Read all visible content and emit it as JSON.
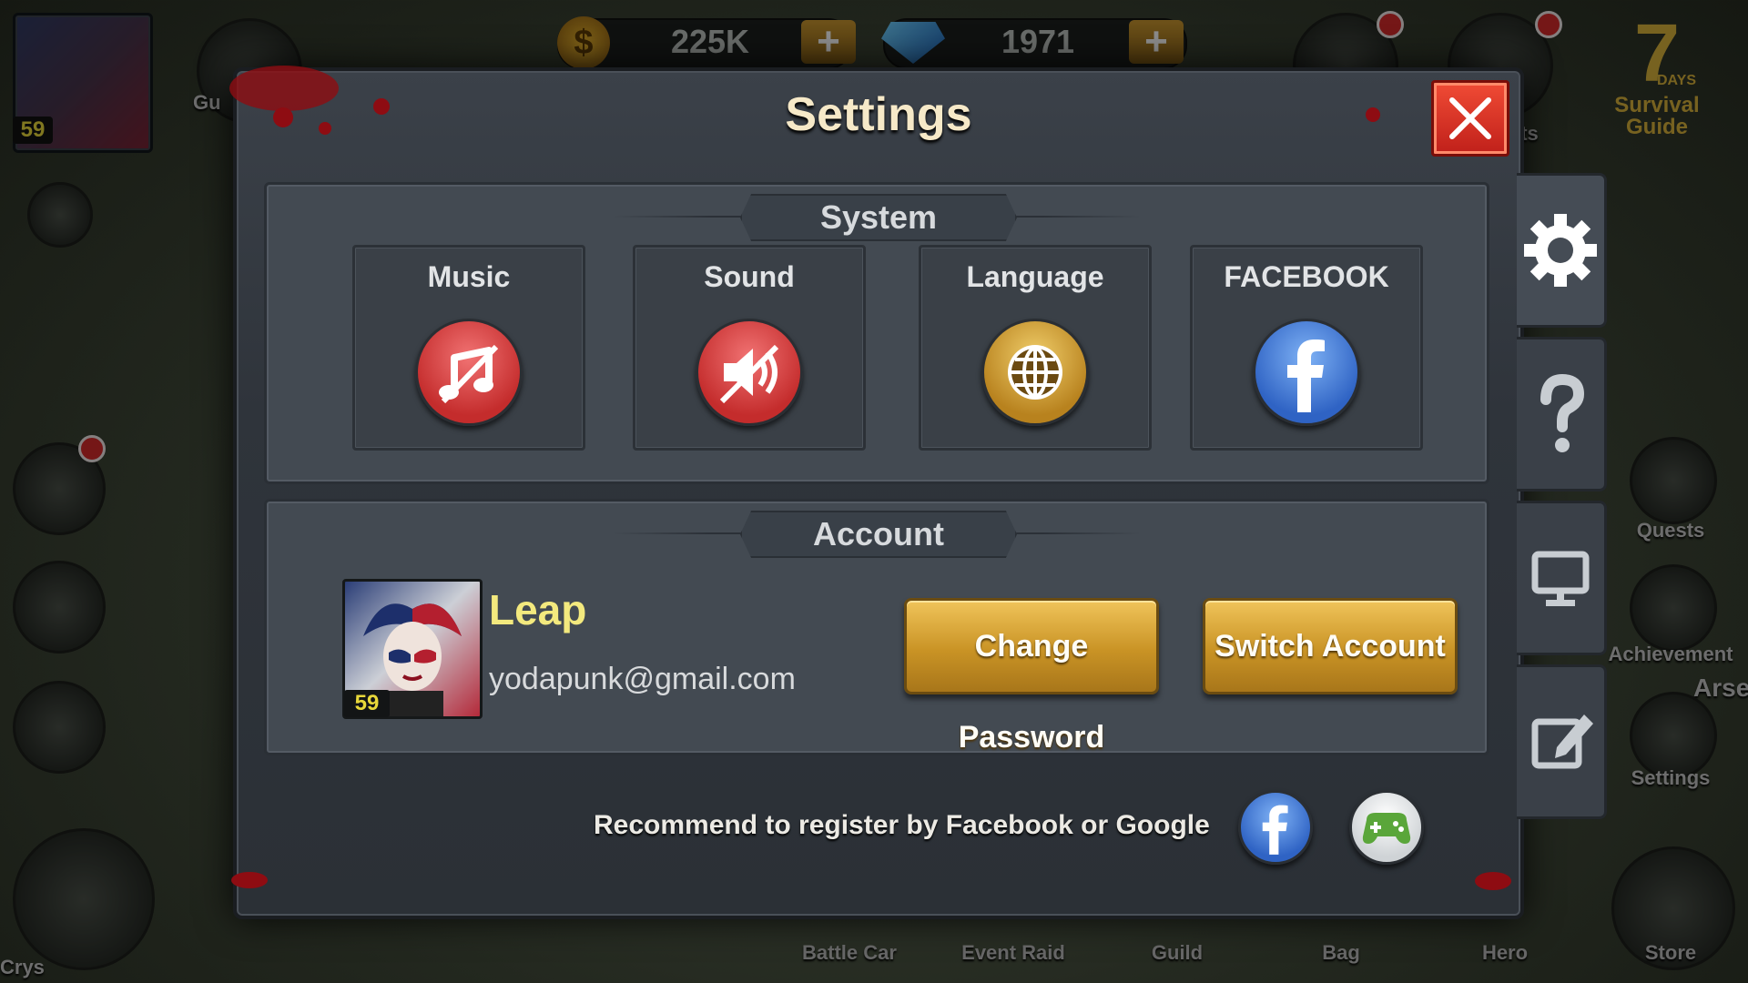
{
  "hud": {
    "player_level": "59",
    "gold_amount": "225K",
    "gem_amount": "1971",
    "gold_symbol": "$",
    "guild_partial": "Gu",
    "gifts_partial": "ts",
    "survival_guide_days": "7",
    "survival_guide_days_label": "DAYS",
    "survival_guide_label": "Survival Guide",
    "right_menu": [
      "Quests",
      "Achievement",
      "Settings"
    ],
    "arsenal_partial": "Arse",
    "bottom_menu": [
      "Battle Car",
      "Event Raid",
      "Guild",
      "Bag",
      "Hero",
      "Store"
    ],
    "crystal_partial": "Crys"
  },
  "dialog": {
    "title": "Settings",
    "system": {
      "heading": "System",
      "options": [
        {
          "label": "Music",
          "icon": "music-note-icon",
          "color": "#d94545"
        },
        {
          "label": "Sound",
          "icon": "sound-muted-icon",
          "color": "#d94545"
        },
        {
          "label": "Language",
          "icon": "globe-icon",
          "color": "#d9a63a"
        },
        {
          "label": "FACEBOOK",
          "icon": "facebook-icon",
          "color": "#3f78d8"
        }
      ]
    },
    "account": {
      "heading": "Account",
      "level": "59",
      "username": "Leap",
      "email": "yodapunk@gmail.com",
      "change_password_label": "Change Password",
      "switch_account_label": "Switch Account"
    },
    "recommend_text": "Recommend to register by Facebook or Google"
  },
  "side_tabs": [
    "gear-icon",
    "help-icon",
    "monitor-icon",
    "edit-icon"
  ],
  "colors": {
    "accent_gold": "#c99325",
    "close_red": "#d9321f",
    "username_yellow": "#f3e97e",
    "level_yellow": "#e8d83a"
  }
}
